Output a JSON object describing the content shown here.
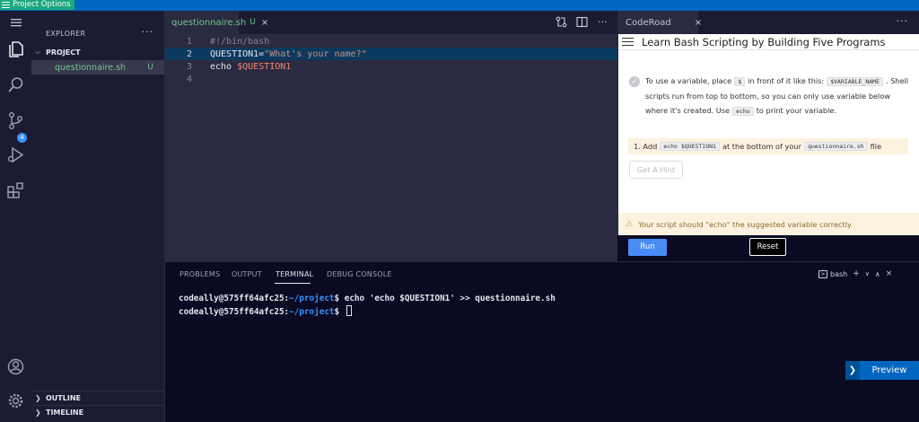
{
  "banner": {
    "label": "Project Options",
    "accent": "#1aa87c",
    "bar_color": "#0067c0"
  },
  "activity_bar": {
    "icons": [
      "menu-icon",
      "files-icon",
      "search-icon",
      "source-control-icon",
      "run-debug-icon",
      "extensions-icon",
      "account-icon",
      "settings-gear-icon"
    ],
    "source_control_badge": "4"
  },
  "sidebar": {
    "title": "EXPLORER",
    "more": "···",
    "project_label": "PROJECT",
    "files": [
      {
        "name": "questionnaire.sh",
        "status": "U"
      }
    ],
    "outline_label": "OUTLINE",
    "timeline_label": "TIMELINE"
  },
  "editor": {
    "tab": {
      "name": "questionnaire.sh",
      "status": "U",
      "close": "×"
    },
    "lines": [
      {
        "n": "1",
        "text": "#!/bin/bash"
      },
      {
        "n": "2",
        "text": "QUESTION1=\"What's your name?\""
      },
      {
        "n": "3",
        "text": "echo $QUESTION1"
      },
      {
        "n": "4",
        "text": ""
      }
    ],
    "line2_var": "QUESTION1=",
    "line2_str": "\"What's your name?\"",
    "line3_cmd": "echo ",
    "line3_var": "$QUESTION1",
    "highlight_color": "#0c3a5e"
  },
  "coderoad": {
    "tab_label": "CodeRoad",
    "tab_close": "×",
    "more": "···",
    "title": "Learn Bash Scripting by Building Five Programs",
    "desc_part1": "To use a variable, place",
    "desc_chip1": "$",
    "desc_part2": "in front of it like this:",
    "desc_chip2": "$VARIABLE_NAME",
    "desc_part3": ". Shell scripts run from top to bottom, so you can only use variable below where it's created. Use",
    "desc_chip3": "echo",
    "desc_part4": "to print your variable.",
    "task_prefix": "1. Add",
    "task_chip1": "echo $QUESTION1",
    "task_mid": "at the bottom of your",
    "task_chip2": "questionnaire.sh",
    "task_suffix": "file",
    "hint_label": "Get A Hint",
    "warning": "Your script should \"echo\" the suggested variable correctly",
    "run_label": "Run",
    "reset_label": "Reset"
  },
  "panel": {
    "tabs": [
      "PROBLEMS",
      "OUTPUT",
      "TERMINAL",
      "DEBUG CONSOLE"
    ],
    "active_tab": "TERMINAL",
    "shell": "bash",
    "terminal_lines": [
      {
        "user": "codeally@575ff64afc25",
        "path": "~/project",
        "cmd": "echo 'echo $QUESTION1' >> questionnaire.sh"
      },
      {
        "user": "codeally@575ff64afc25",
        "path": "~/project",
        "cmd": ""
      }
    ]
  },
  "preview": {
    "label": "Preview"
  }
}
